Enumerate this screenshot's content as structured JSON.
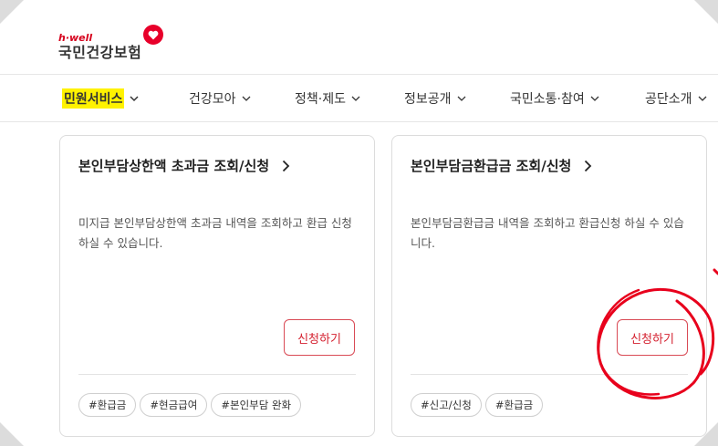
{
  "logo": {
    "small": "h·well",
    "main": "국민건강보험"
  },
  "nav": [
    {
      "label": "민원서비스",
      "active": true
    },
    {
      "label": "건강모아"
    },
    {
      "label": "정책·제도"
    },
    {
      "label": "정보공개"
    },
    {
      "label": "국민소통·참여"
    },
    {
      "label": "공단소개"
    }
  ],
  "cards": [
    {
      "title": "본인부담상한액 초과금 조회/신청",
      "desc": "미지급 본인부담상한액 초과금 내역을 조회하고 환급 신청 하실 수 있습니다.",
      "button": "신청하기",
      "tags": [
        "#환급금",
        "#현금급여",
        "#본인부담 완화"
      ]
    },
    {
      "title": "본인부담금환급금 조회/신청",
      "desc": "본인부담금환급금 내역을 조회하고 환급신청 하실 수 있습니다.",
      "button": "신청하기",
      "tags": [
        "#신고/신청",
        "#환급금"
      ]
    }
  ],
  "colors": {
    "accent": "#d4202f",
    "highlight": "#fff200",
    "annotation": "#e8001c"
  }
}
